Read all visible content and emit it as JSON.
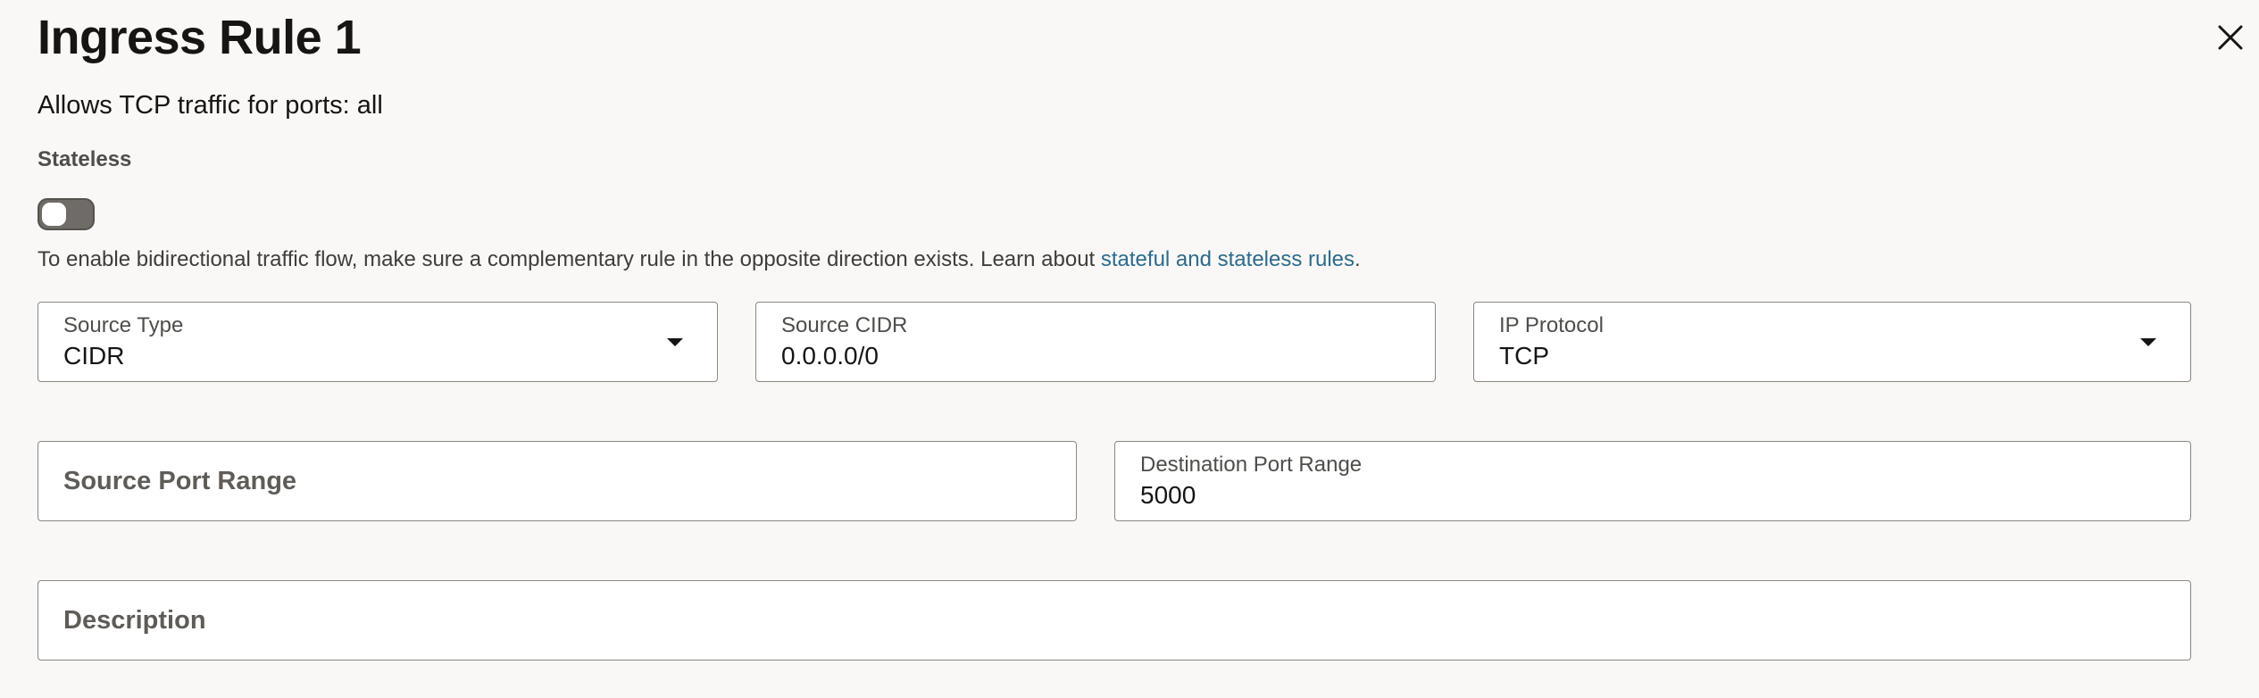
{
  "panel": {
    "title": "Ingress Rule 1",
    "subtitle": "Allows TCP traffic for ports: all",
    "close_icon": "close-icon"
  },
  "stateless": {
    "label": "Stateless",
    "enabled": false
  },
  "help": {
    "text": "To enable bidirectional traffic flow, make sure a complementary rule in the opposite direction exists. Learn about ",
    "link_text": "stateful and stateless rules",
    "suffix": "."
  },
  "fields": {
    "source_type": {
      "label": "Source Type",
      "value": "CIDR"
    },
    "source_cidr": {
      "label": "Source CIDR",
      "value": "0.0.0.0/0"
    },
    "ip_protocol": {
      "label": "IP Protocol",
      "value": "TCP"
    },
    "source_port_range": {
      "placeholder": "Source Port Range"
    },
    "destination_port_range": {
      "label": "Destination Port Range",
      "value": "5000"
    },
    "description": {
      "placeholder": "Description"
    }
  },
  "colors": {
    "background": "#f9f8f6",
    "link": "#2b6b8d",
    "field_border": "#8a8781",
    "toggle_off": "#6f6b66"
  }
}
